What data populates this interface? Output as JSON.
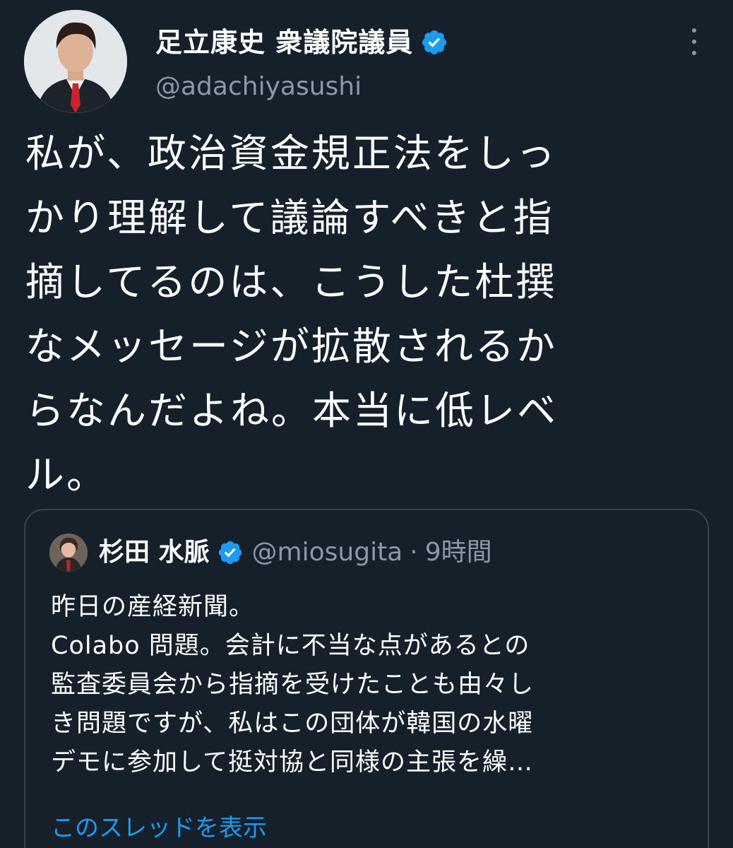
{
  "tweet": {
    "author": {
      "name": "足立康史 衆議院議員",
      "handle": "@adachiyasushi",
      "avatar_icon": "avatar-photo-icon",
      "verified_icon": "verified-badge-icon"
    },
    "text_lines": [
      "私が、政治資金規正法をしっ",
      "かり理解して議論すべきと指",
      "摘してるのは、こうした杜撰",
      "なメッセージが拡散されるか",
      "らなんだよね。本当に低レベ",
      "ル。"
    ],
    "more_icon": "more-options-icon"
  },
  "quoted": {
    "author": {
      "name": "杉田 水脈",
      "handle": "@miosugita",
      "separator": "·",
      "time": "9時間",
      "avatar_icon": "avatar-photo-icon",
      "verified_icon": "verified-badge-icon"
    },
    "text_lines": [
      "昨日の産経新聞。",
      "Colabo 問題。会計に不当な点があるとの",
      "監査委員会から指摘を受けたことも由々し",
      "き問題ですが、私はこの団体が韓国の水曜",
      "デモに参加して挺対協と同様の主張を繰…"
    ],
    "show_thread_label": "このスレッドを表示"
  },
  "colors": {
    "background": "#15202b",
    "text": "#ffffff",
    "secondary_text": "#8b98a5",
    "accent": "#1d9bf0",
    "border": "#38444d"
  }
}
